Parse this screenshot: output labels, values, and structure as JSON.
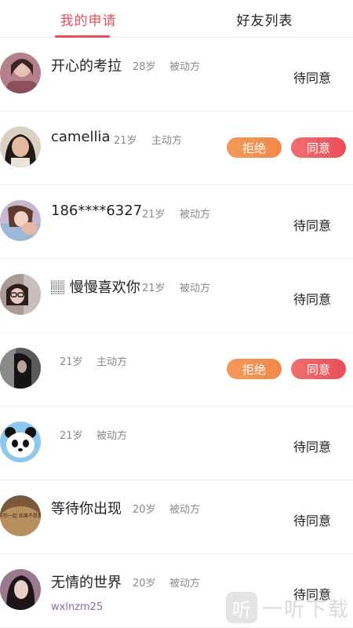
{
  "tabs": [
    {
      "label": "我的申请",
      "active": true
    },
    {
      "label": "好友列表",
      "active": false
    }
  ],
  "requests": [
    {
      "name": "开心的考拉",
      "age": "28岁",
      "role": "被动方",
      "status": "待同意",
      "avatar": "avatar-1"
    },
    {
      "name": "camellia",
      "age": "21岁",
      "role": "主动方",
      "actions": [
        "拒绝",
        "同意"
      ],
      "avatar": "avatar-2"
    },
    {
      "name": "186****6327",
      "age": "21岁",
      "role": "被动方",
      "status": "待同意",
      "avatar": "avatar-3"
    },
    {
      "name": "🏽 慢慢喜欢你",
      "age": "21岁",
      "role": "被动方",
      "status": "待同意",
      "avatar": "avatar-4"
    },
    {
      "name": "",
      "age": "21岁",
      "role": "主动方",
      "actions": [
        "拒绝",
        "同意"
      ],
      "avatar": "avatar-5"
    },
    {
      "name": "",
      "age": "21岁",
      "role": "被动方",
      "status": "待同意",
      "avatar": "panda"
    },
    {
      "name": "等待你出现",
      "age": "20岁",
      "role": "被动方",
      "status": "待同意",
      "avatar": "avatar-7",
      "avatar_text": "曾经与你一起 如果不是那一样"
    },
    {
      "name": "无情的世界",
      "age": "20岁",
      "role": "被动方",
      "status": "待同意",
      "subtext": "wxlnzm25",
      "avatar": "avatar-8"
    }
  ],
  "watermark": {
    "logo": "听",
    "text": "一听下载"
  },
  "colors": {
    "accent": "#e8505b",
    "reject": "#f2884a",
    "agree": "#ea4f5a"
  }
}
